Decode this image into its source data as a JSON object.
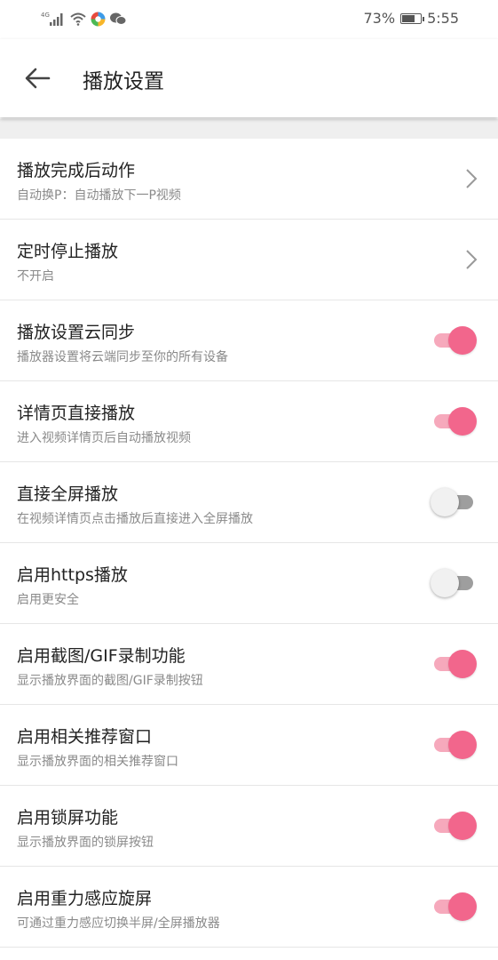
{
  "status_bar": {
    "network_type": "4G",
    "battery_percent": "73%",
    "time": "5:55",
    "battery_level": 0.73,
    "icons": [
      "signal-icon",
      "wifi-icon",
      "app-notification-icon",
      "wechat-icon",
      "battery-icon"
    ]
  },
  "header": {
    "title": "播放设置",
    "back_icon": "arrow-left-icon"
  },
  "colors": {
    "accent": "#f2668c",
    "accent_track": "#f6a9bc",
    "off_track": "#9e9e9e",
    "off_knob": "#f1f1f1",
    "secondary_text": "#8a8a8a",
    "divider": "#e6e6e6"
  },
  "settings": [
    {
      "title": "播放完成后动作",
      "subtitle": "自动换P：自动播放下一P视频",
      "control": "chevron"
    },
    {
      "title": "定时停止播放",
      "subtitle": "不开启",
      "control": "chevron"
    },
    {
      "title": "播放设置云同步",
      "subtitle": "播放器设置将云端同步至你的所有设备",
      "control": "toggle",
      "enabled": true
    },
    {
      "title": "详情页直接播放",
      "subtitle": "进入视频详情页后自动播放视频",
      "control": "toggle",
      "enabled": true
    },
    {
      "title": "直接全屏播放",
      "subtitle": "在视频详情页点击播放后直接进入全屏播放",
      "control": "toggle",
      "enabled": false
    },
    {
      "title": "启用https播放",
      "subtitle": "启用更安全",
      "control": "toggle",
      "enabled": false
    },
    {
      "title": "启用截图/GIF录制功能",
      "subtitle": "显示播放界面的截图/GIF录制按钮",
      "control": "toggle",
      "enabled": true
    },
    {
      "title": "启用相关推荐窗口",
      "subtitle": "显示播放界面的相关推荐窗口",
      "control": "toggle",
      "enabled": true
    },
    {
      "title": "启用锁屏功能",
      "subtitle": "显示播放界面的锁屏按钮",
      "control": "toggle",
      "enabled": true
    },
    {
      "title": "启用重力感应旋屏",
      "subtitle": "可通过重力感应切换半屏/全屏播放器",
      "control": "toggle",
      "enabled": true
    }
  ]
}
